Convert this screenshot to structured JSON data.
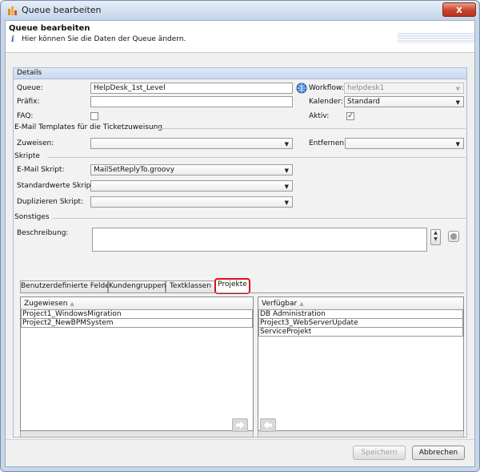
{
  "window": {
    "title": "Queue bearbeiten",
    "close_glyph": "x"
  },
  "header": {
    "title": "Queue bearbeiten",
    "info_glyph": "i",
    "description": "Hier können Sie die Daten der Queue ändern."
  },
  "details": {
    "section_title": "Details",
    "queue": {
      "label": "Queue:",
      "value": "HelpDesk_1st_Level"
    },
    "praefix": {
      "label": "Präfix:",
      "value": ""
    },
    "faq": {
      "label": "FAQ:",
      "checked": false
    },
    "workflow": {
      "label": "Workflow:",
      "value": "helpdesk1"
    },
    "kalender": {
      "label": "Kalender:",
      "value": "Standard"
    },
    "aktiv": {
      "label": "Aktiv:",
      "checked": true,
      "check_glyph": "✓"
    }
  },
  "email_templates": {
    "section_title": "E-Mail Templates für die Ticketzuweisung",
    "zuweisen": {
      "label": "Zuweisen:",
      "value": ""
    },
    "entfernen": {
      "label": "Entfernen:",
      "value": ""
    }
  },
  "skripte": {
    "section_title": "Skripte",
    "email_skript": {
      "label": "E-Mail Skript:",
      "value": "MailSetReplyTo.groovy"
    },
    "standardwerte_skript": {
      "label": "Standardwerte Skript:",
      "value": ""
    },
    "duplizieren_skript": {
      "label": "Duplizieren Skript:",
      "value": ""
    }
  },
  "sonstiges": {
    "section_title": "Sonstiges",
    "beschreibung": {
      "label": "Beschreibung:",
      "value": ""
    },
    "spinner_up": "▲",
    "spinner_down": "▼"
  },
  "tabs": [
    {
      "label": "Benutzerdefinierte Felder",
      "selected": false
    },
    {
      "label": "Kundengruppen",
      "selected": false
    },
    {
      "label": "Textklassen",
      "selected": false
    },
    {
      "label": "Projekte",
      "selected": true
    }
  ],
  "lists": {
    "sort_glyph": "▲",
    "assigned": {
      "header": "Zugewiesen",
      "items": [
        "Project1_WindowsMigration",
        "Project2_NewBPMSystem"
      ]
    },
    "available": {
      "header": "Verfügbar",
      "items": [
        "DB Administration",
        "Project3_WebServerUpdate",
        "ServiceProjekt"
      ]
    }
  },
  "buttons": {
    "save": "Speichern",
    "cancel": "Abbrechen"
  },
  "dropdown_glyph": "▼",
  "colors": {
    "highlight": "#d8101a",
    "title_bar": "#c3d4ea",
    "panel_header": "#c9d9ee"
  }
}
